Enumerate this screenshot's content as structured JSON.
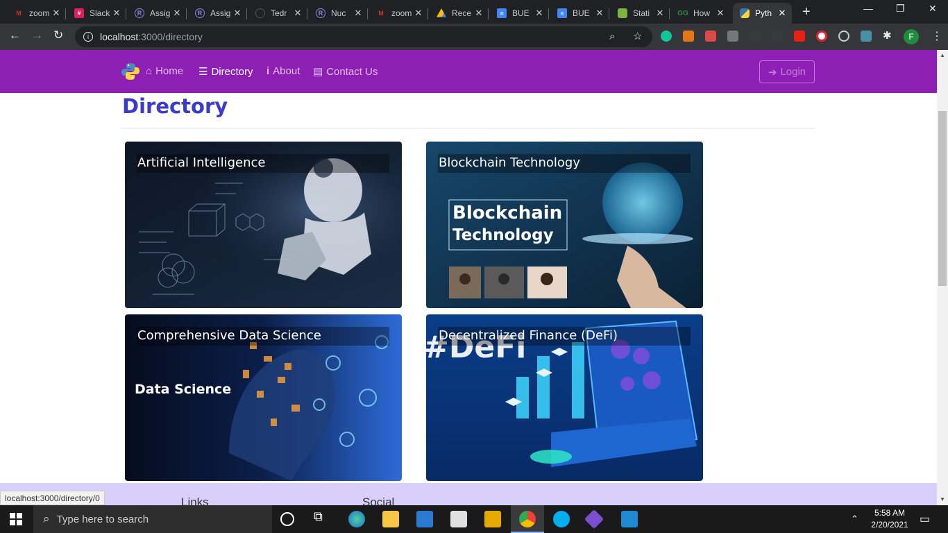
{
  "browser": {
    "tabs": [
      {
        "title": "zoom",
        "icon": "gmail-icon",
        "color": "#d93025"
      },
      {
        "title": "Slack",
        "icon": "slack-icon",
        "color": "#e01e5a"
      },
      {
        "title": "Assig",
        "icon": "r-icon",
        "color": "#6b5bd2"
      },
      {
        "title": "Assig",
        "icon": "r-icon",
        "color": "#6b5bd2"
      },
      {
        "title": "Tedr",
        "icon": "github-icon",
        "color": "#333333"
      },
      {
        "title": "Nuc",
        "icon": "r-icon",
        "color": "#6b5bd2"
      },
      {
        "title": "zoom",
        "icon": "gmail-icon",
        "color": "#d93025"
      },
      {
        "title": "Rece",
        "icon": "drive-icon",
        "color": "#fbbc04"
      },
      {
        "title": "BUE",
        "icon": "docs-icon",
        "color": "#4285f4"
      },
      {
        "title": "BUE",
        "icon": "docs-icon",
        "color": "#4285f4"
      },
      {
        "title": "Stati",
        "icon": "node-icon",
        "color": "#7cb342"
      },
      {
        "title": "How",
        "icon": "gfg-icon",
        "color": "#2f8d46"
      },
      {
        "title": "Pyth",
        "icon": "python-icon",
        "color": "#3776ab",
        "active": true
      }
    ],
    "url_host": "localhost",
    "url_path": ":3000/directory"
  },
  "nav": {
    "links": [
      {
        "label": "Home",
        "icon": "home-icon"
      },
      {
        "label": "Directory",
        "icon": "list-icon",
        "active": true
      },
      {
        "label": "About",
        "icon": "info-icon"
      },
      {
        "label": "Contact Us",
        "icon": "address-card-icon"
      }
    ],
    "login_label": "Login"
  },
  "page": {
    "title": "Directory"
  },
  "cards": [
    {
      "label": "Artificial Intelligence"
    },
    {
      "label": "Blockchain Technology",
      "image_text_1": "Blockchain",
      "image_text_2": "Technology"
    },
    {
      "label": "Comprehensive Data Science",
      "image_text": "Data Science"
    },
    {
      "label": "Decentralized Finance (DeFi)",
      "image_text": "#DeFi"
    }
  ],
  "footer": {
    "headings": [
      "Links",
      "Social"
    ]
  },
  "status_bar": {
    "url": "localhost:3000/directory/0"
  },
  "taskbar": {
    "search_placeholder": "Type here to search",
    "time": "5:58 AM",
    "date": "2/20/2021"
  },
  "colors": {
    "navbar": "#8e1fb5",
    "title": "#3a3acd",
    "footer": "#d8d0fa"
  }
}
